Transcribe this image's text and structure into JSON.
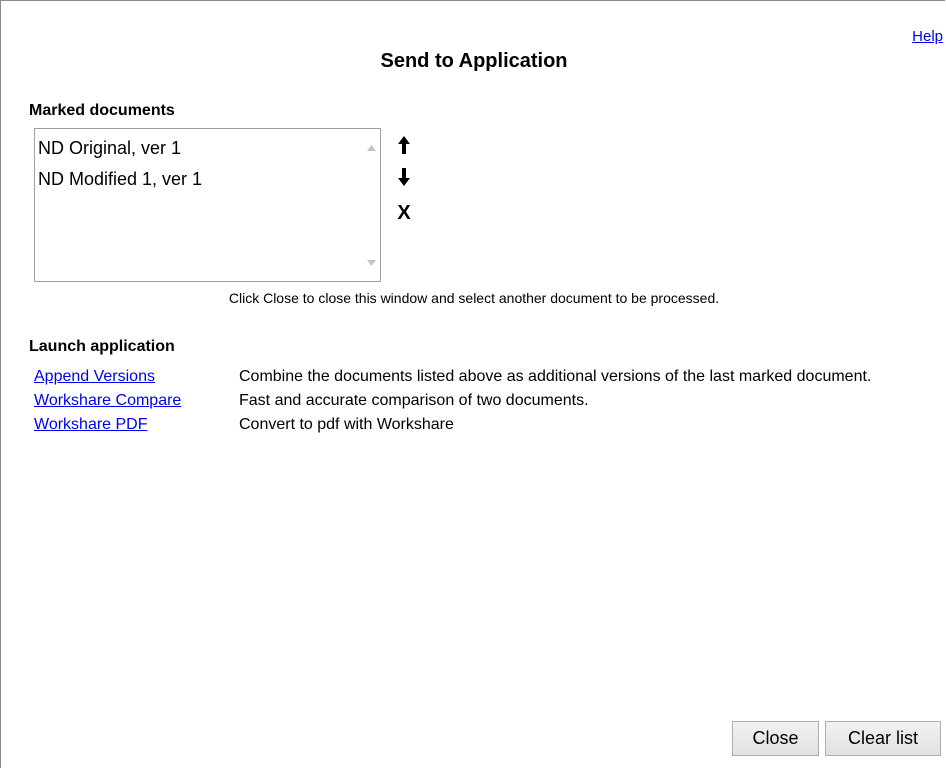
{
  "header": {
    "help_label": "Help",
    "title": "Send to Application"
  },
  "marked_documents": {
    "label": "Marked documents",
    "items": [
      "ND Original, ver 1",
      "ND Modified 1, ver 1"
    ],
    "move_up_icon": "arrow-up-icon",
    "move_down_icon": "arrow-down-icon",
    "remove_label": "X",
    "hint": "Click Close to close this window and select another document to be processed."
  },
  "launch": {
    "label": "Launch application",
    "apps": [
      {
        "name": "Append Versions",
        "description": "Combine the documents listed above as additional versions of the last marked document."
      },
      {
        "name": "Workshare Compare",
        "description": "Fast and accurate comparison of two documents."
      },
      {
        "name": "Workshare PDF",
        "description": "Convert to pdf with Workshare"
      }
    ]
  },
  "footer": {
    "close_label": "Close",
    "clear_label": "Clear list"
  },
  "colors": {
    "link": "#0000ee",
    "border": "#a0a0a0",
    "button_face": "#e1e1e1"
  }
}
